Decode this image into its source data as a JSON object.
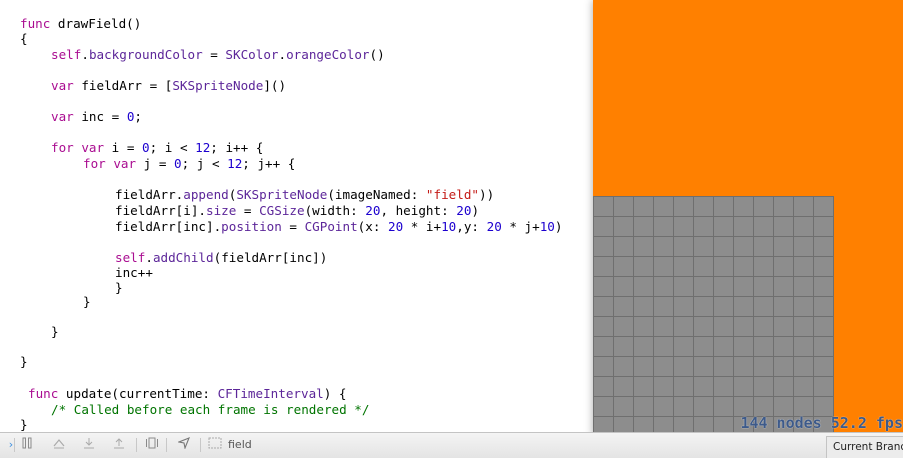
{
  "editor": {
    "tokens": {
      "func": "func",
      "self": "self",
      "var": "var",
      "for": "for",
      "zero": "0",
      "twelve": "12",
      "twenty": "20",
      "ten": "10",
      "SKColor": "SKColor",
      "orangeColor": "orangeColor",
      "SKSpriteNode": "SKSpriteNode",
      "CGSize": "CGSize",
      "CGPoint": "CGPoint",
      "CFTimeInterval": "CFTimeInterval",
      "str_field": "\"field\"",
      "comment": "/* Called before each frame is rendered */"
    }
  },
  "simulator": {
    "background_color": "#ff8000",
    "grid_color": "#8d8d8d",
    "stats": "144 nodes  52.2 fps"
  },
  "debug_bar": {
    "frame_label": "field",
    "icons": [
      "breakpoints-toggle-icon",
      "pause-icon",
      "step-over-icon",
      "step-into-icon",
      "step-out-icon",
      "view-debugger-icon",
      "location-icon",
      "frame-icon"
    ]
  },
  "source_control": {
    "branch_label": "Current Branch"
  }
}
